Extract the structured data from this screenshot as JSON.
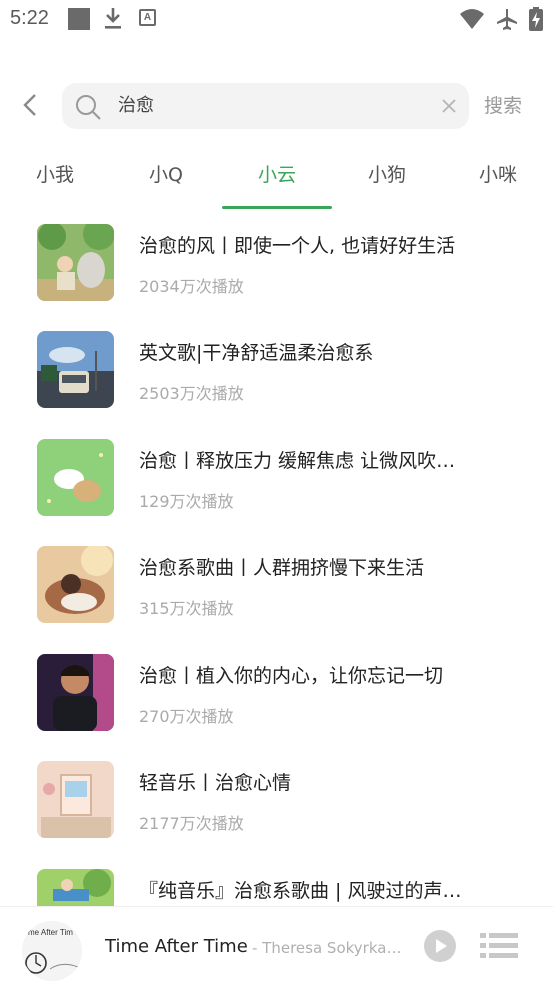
{
  "status_bar": {
    "time": "5:22",
    "icons": [
      "square-notification-icon",
      "download-icon",
      "a-badge-icon",
      "wifi-icon",
      "airplane-icon",
      "battery-charging-icon"
    ]
  },
  "search": {
    "query": "治愈",
    "button_label": "搜索"
  },
  "tabs": [
    {
      "label": "小我"
    },
    {
      "label": "小Q"
    },
    {
      "label": "小云",
      "active": true
    },
    {
      "label": "小狗"
    },
    {
      "label": "小咪"
    }
  ],
  "playlists": [
    {
      "title": "治愈的风丨即使一个人, 也请好好生活",
      "plays": "2034万次播放"
    },
    {
      "title": "英文歌|干净舒适温柔治愈系",
      "plays": "2503万次播放"
    },
    {
      "title": "治愈丨释放压力 缓解焦虑 让微风吹…",
      "plays": "129万次播放"
    },
    {
      "title": "治愈系歌曲丨人群拥挤慢下来生活",
      "plays": "315万次播放"
    },
    {
      "title": "治愈丨植入你的内心，让你忘记一切",
      "plays": "270万次播放"
    },
    {
      "title": "轻音乐丨治愈心情",
      "plays": "2177万次播放"
    },
    {
      "title": "『纯音乐』治愈系歌曲 | 风驶过的声…",
      "plays": ""
    }
  ],
  "player": {
    "song": "Time After Time",
    "artist": "- Theresa Sokyrka ...",
    "cover_text": "me After Tim"
  },
  "colors": {
    "accent": "#3aa65a",
    "text_primary": "#222222",
    "text_secondary": "#aaaaaa",
    "search_bg": "#f3f3f3"
  }
}
